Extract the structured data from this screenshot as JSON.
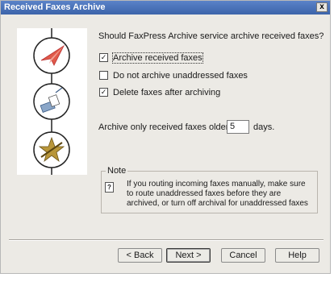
{
  "window": {
    "title": "Received Faxes Archive",
    "close_glyph": "x"
  },
  "art": {
    "icons": [
      "paper-plane-icon",
      "fax-scan-icon",
      "archive-star-icon"
    ]
  },
  "main": {
    "question": "Should FaxPress Archive service archive received faxes?",
    "checkboxes": [
      {
        "label": "Archive received faxes",
        "checked": true,
        "focused": true
      },
      {
        "label": "Do not archive unaddressed faxes",
        "checked": false,
        "focused": false
      },
      {
        "label": "Delete faxes after archiving",
        "checked": true,
        "focused": false
      }
    ],
    "days_label": "Archive only received faxes older than",
    "days_value": "5",
    "days_unit": "days."
  },
  "note": {
    "title": "Note",
    "icon_glyph": "?",
    "text": "If you routing incoming faxes manually, make sure to route unaddressed faxes before they are archived, or turn off archival for unaddressed faxes"
  },
  "buttons": {
    "back": "< Back",
    "next": "Next >",
    "cancel": "Cancel",
    "help": "Help"
  },
  "check_glyph": "✓"
}
